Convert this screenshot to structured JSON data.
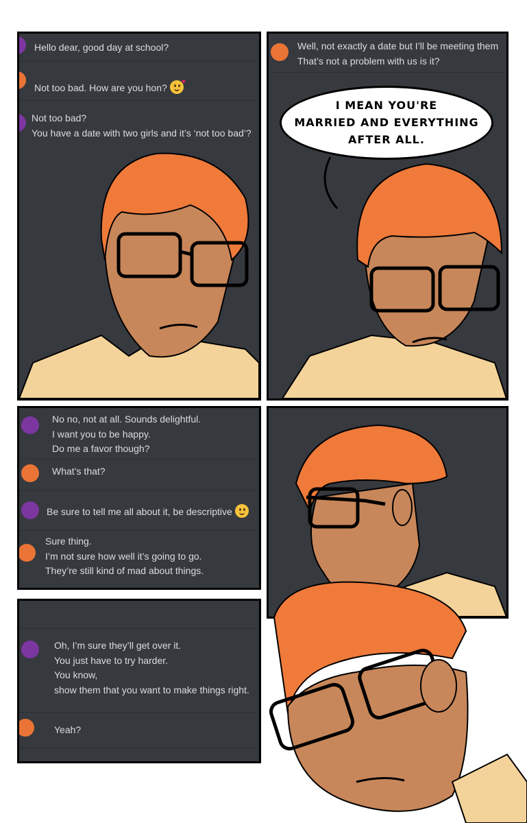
{
  "panel1": {
    "messages": [
      {
        "avatar": "purple",
        "lines": [
          "Hello dear, good day at school?"
        ]
      },
      {
        "avatar": "orange",
        "lines": [
          "Not too bad. How are you hon?"
        ],
        "emoji": "kissing-heart-emoji"
      },
      {
        "avatar": "purple",
        "lines": [
          "Not too bad?",
          "You have a date with two girls and it’s ‘not too bad’?"
        ]
      }
    ]
  },
  "panel2": {
    "messages": [
      {
        "avatar": "orange",
        "lines": [
          "Well, not exactly a date but I’ll be meeting them",
          "That’s not a problem with us is it?"
        ]
      }
    ],
    "speech_bubble": [
      "I MEAN YOU'RE",
      "MARRIED AND EVERYTHING",
      "AFTER ALL."
    ]
  },
  "panel3": {
    "messages": [
      {
        "avatar": "purple",
        "lines": [
          "No no, not at all. Sounds delightful.",
          "I want you to be happy.",
          "Do me a favor though?"
        ]
      },
      {
        "avatar": "orange",
        "lines": [
          "What’s that?"
        ]
      },
      {
        "avatar": "purple",
        "lines": [
          "Be sure to tell me all about it, be descriptive"
        ],
        "emoji": "wink-emoji"
      },
      {
        "avatar": "orange",
        "lines": [
          "Sure thing.",
          "I’m not sure how well it’s going to go.",
          "They’re still kind of mad about things."
        ]
      }
    ]
  },
  "panel5": {
    "messages": [
      {
        "avatar": "purple",
        "lines": [
          "Oh, I’m sure they’ll get over it.",
          "You just have to try harder.",
          "You know,",
          "show them that you want to make things right."
        ]
      },
      {
        "avatar": "orange",
        "lines": [
          "Yeah?"
        ]
      }
    ]
  },
  "colors": {
    "chat_bg": "#36393e",
    "text": "#dcddde",
    "avatar_purple": "#7b36a0",
    "avatar_orange": "#ea7436",
    "hair": "#ef7a3a",
    "skin": "#c8875a",
    "shirt": "#f4d39a"
  }
}
